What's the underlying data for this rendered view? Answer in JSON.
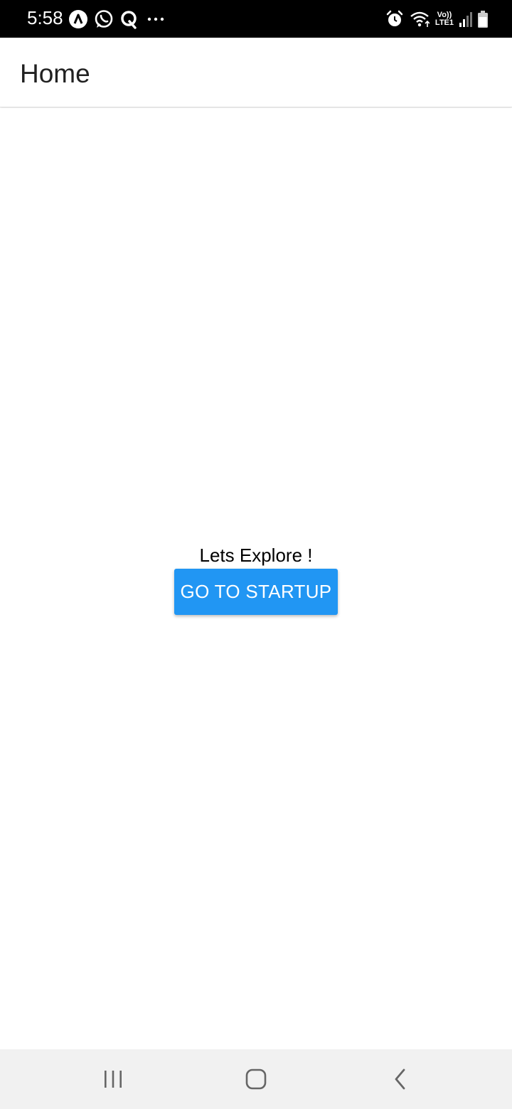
{
  "status_bar": {
    "time": "5:58",
    "left_icons": [
      "navigation-app-icon",
      "whatsapp-icon",
      "quora-icon",
      "more-notifications-icon"
    ],
    "right_icons": [
      "alarm-icon",
      "wifi-icon",
      "volte-lte-icon",
      "signal-icon",
      "battery-icon"
    ],
    "volte_label": "Vo))",
    "lte_label": "LTE1"
  },
  "app_bar": {
    "title": "Home"
  },
  "main": {
    "welcome_text": "Lets Explore !",
    "button_label": "GO TO STARTUP"
  },
  "nav_bar": {
    "buttons": [
      "recent-apps-icon",
      "home-icon",
      "back-icon"
    ]
  },
  "colors": {
    "status_bar": "#000000",
    "button": "#2196f3",
    "nav_bar": "#f1f1f1"
  }
}
